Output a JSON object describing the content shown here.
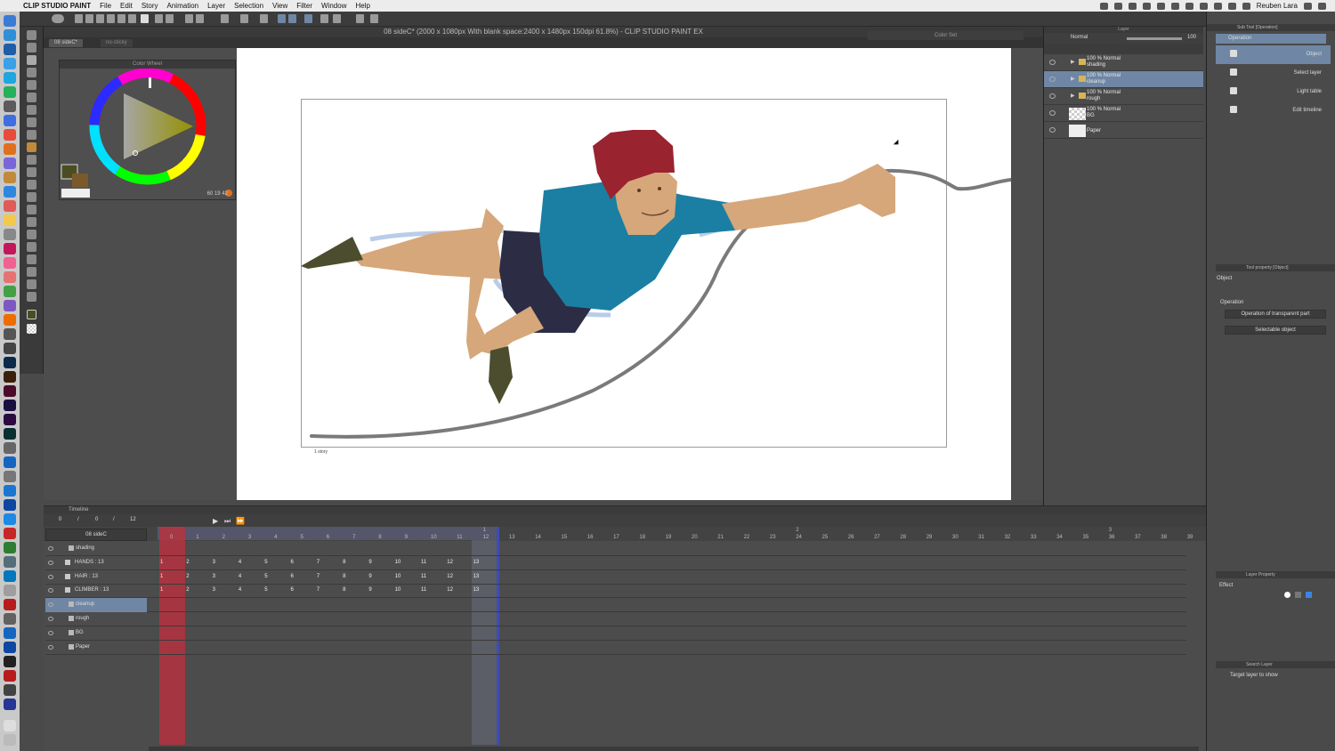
{
  "menubar": {
    "app_name": "CLIP STUDIO PAINT",
    "items": [
      "File",
      "Edit",
      "Story",
      "Animation",
      "Layer",
      "Selection",
      "View",
      "Filter",
      "Window",
      "Help"
    ],
    "user": "Reuben Lara"
  },
  "document": {
    "title": "08 sideC* (2000 x 1080px With blank space:2400 x 1480px 150dpi 61.8%)  - CLIP STUDIO PAINT EX",
    "tabs": [
      "08 sideC*",
      "no-sticky"
    ],
    "frame_label": "1 story"
  },
  "color_wheel": {
    "title": "Color Wheel",
    "h": "60",
    "s": "19",
    "v": "42",
    "main_color": "#4a4d22",
    "sub_color": "#7a5a2a"
  },
  "color_set": {
    "title": "Color Set"
  },
  "layer_panel": {
    "title": "Layer",
    "blend_mode": "Normal",
    "opacity": "100",
    "layers": [
      {
        "line1": "100 % Normal",
        "line2": "shading",
        "type": "folder",
        "selected": false
      },
      {
        "line1": "100 % Normal",
        "line2": "cleanup",
        "type": "folder",
        "selected": true
      },
      {
        "line1": "100 % Normal",
        "line2": "rough",
        "type": "folder",
        "selected": false
      },
      {
        "line1": "100 % Normal",
        "line2": "BG",
        "type": "raster",
        "selected": false
      },
      {
        "line1": "",
        "line2": "Paper",
        "type": "paper",
        "selected": false
      }
    ]
  },
  "sub_tool": {
    "title": "Sub Tool [Operation]",
    "group": "Operation",
    "items": [
      "Object",
      "Select layer",
      "Light table",
      "Edit timeline"
    ],
    "tool_property_title": "Tool property [Object]",
    "tool_property_name": "Object",
    "operation_label": "Operation",
    "transparent_part": "Operation of transparent part",
    "selectable": "Selectable object",
    "layer_property_title": "Layer Property",
    "effect_label": "Effect",
    "search_layer_title": "Search Layer",
    "target_layer": "Target layer to show"
  },
  "timeline": {
    "title": "Timeline",
    "ctrl_values": [
      "0",
      "/",
      "0",
      "/",
      "12"
    ],
    "track_name": "08 sideC",
    "frame_numbers": [
      "0",
      "1",
      "2",
      "3",
      "4",
      "5",
      "6",
      "7",
      "8",
      "9",
      "10",
      "11",
      "12",
      "13",
      "14",
      "15",
      "16",
      "17",
      "18",
      "19",
      "20",
      "21",
      "22",
      "23",
      "24",
      "25",
      "26",
      "27",
      "28",
      "29",
      "30",
      "31",
      "32",
      "33",
      "34",
      "35",
      "36",
      "37",
      "38",
      "39"
    ],
    "second_markers": [
      "1",
      "2",
      "3"
    ],
    "tracks": [
      {
        "name": "shading",
        "indent": 0,
        "selected": false,
        "cells": []
      },
      {
        "name": "HANDS : 13",
        "indent": 1,
        "selected": false,
        "cells": [
          "1",
          "2",
          "3",
          "4",
          "5",
          "6",
          "7",
          "8",
          "9",
          "10",
          "11",
          "12",
          "13"
        ]
      },
      {
        "name": "HAIR : 13",
        "indent": 1,
        "selected": false,
        "cells": [
          "1",
          "2",
          "3",
          "4",
          "5",
          "6",
          "7",
          "8",
          "9",
          "10",
          "11",
          "12",
          "13"
        ]
      },
      {
        "name": "CLIMBER : 13",
        "indent": 1,
        "selected": false,
        "cells": [
          "1",
          "2",
          "3",
          "4",
          "5",
          "6",
          "7",
          "8",
          "9",
          "10",
          "11",
          "12",
          "13"
        ]
      },
      {
        "name": "cleanup",
        "indent": 0,
        "selected": true,
        "cells": []
      },
      {
        "name": "rough",
        "indent": 0,
        "selected": false,
        "cells": []
      },
      {
        "name": "BG",
        "indent": 0,
        "selected": false,
        "cells": []
      },
      {
        "name": "Paper",
        "indent": 0,
        "selected": false,
        "cells": []
      }
    ]
  },
  "colors": {
    "shirt": "#1a7fa3",
    "shorts": "#2c2c45",
    "skin": "#d6a77a",
    "hair": "#9a2330",
    "shoe": "#4c4d2e",
    "rope": "#7a7a7a",
    "accent_playhead": "#b5323f",
    "selection_blue": "#6f87a5"
  }
}
